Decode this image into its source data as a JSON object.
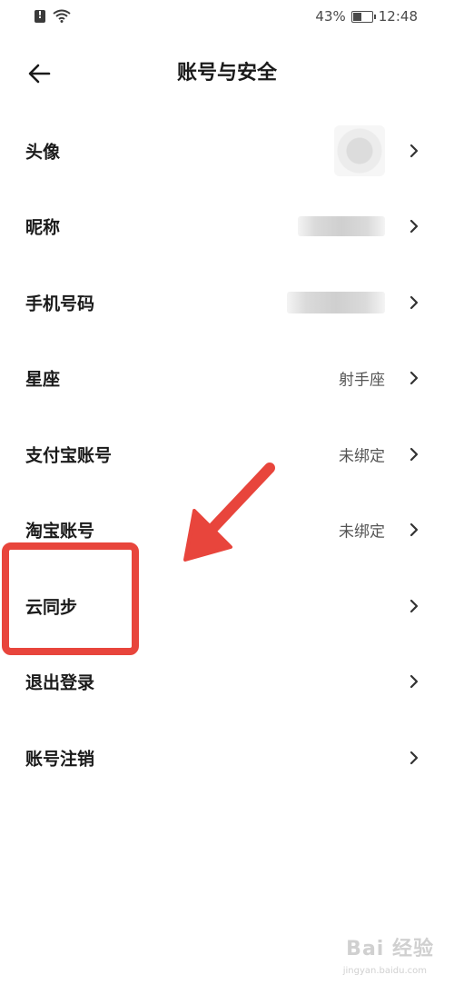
{
  "status_bar": {
    "battery_percent": "43%",
    "time": "12:48",
    "icons": [
      "sim-alert-icon",
      "wifi-icon",
      "battery-icon"
    ]
  },
  "header": {
    "title": "账号与安全",
    "back_icon": "arrow-left-icon"
  },
  "rows": [
    {
      "label": "头像",
      "value": "",
      "kind": "avatar-blurred"
    },
    {
      "label": "昵称",
      "value": "",
      "kind": "nickname-blurred"
    },
    {
      "label": "手机号码",
      "value": "",
      "kind": "phone-blurred"
    },
    {
      "label": "星座",
      "value": "射手座",
      "kind": "text"
    },
    {
      "label": "支付宝账号",
      "value": "未绑定",
      "kind": "text"
    },
    {
      "label": "淘宝账号",
      "value": "未绑定",
      "kind": "text"
    },
    {
      "label": "云同步",
      "value": "",
      "kind": "text"
    },
    {
      "label": "退出登录",
      "value": "",
      "kind": "text"
    },
    {
      "label": "账号注销",
      "value": "",
      "kind": "text"
    }
  ],
  "annotation": {
    "highlight_color": "#e8453c",
    "highlighted_row": "云同步"
  },
  "watermark": {
    "text": "Bai 经验",
    "sub": "jingyan.baidu.com"
  }
}
